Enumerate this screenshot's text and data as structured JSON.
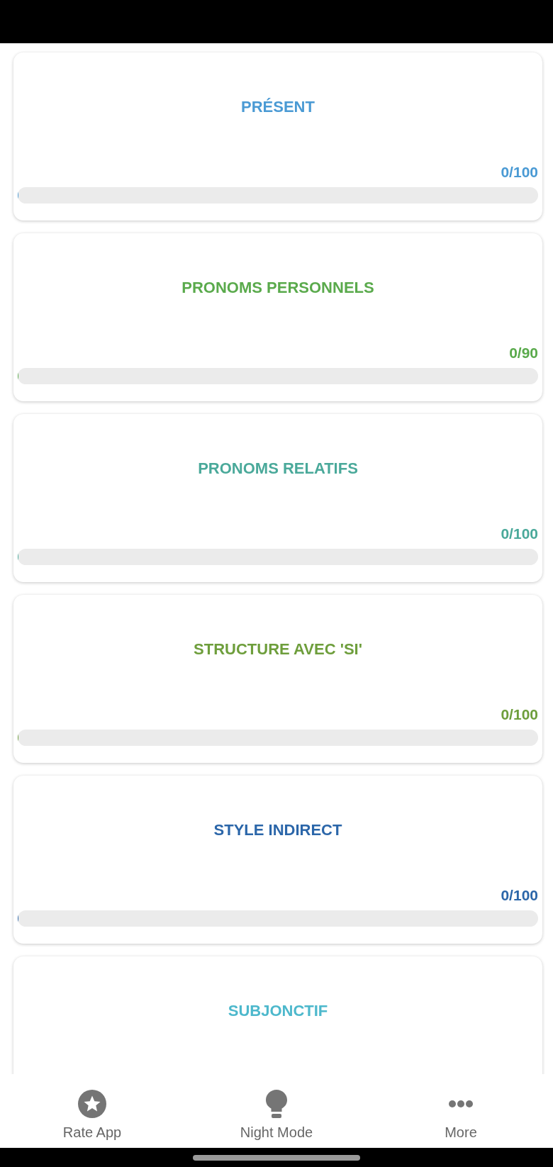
{
  "lessons": [
    {
      "title": "PRÉSENT",
      "color": "#4a9ad4",
      "score": "0/100",
      "level": 0
    },
    {
      "title": "PRONOMS PERSONNELS",
      "color": "#5aaa4c",
      "score": "0/90",
      "level": 0
    },
    {
      "title": "PRONOMS RELATIFS",
      "color": "#4aa99a",
      "score": "0/100",
      "level": 0
    },
    {
      "title": "STRUCTURE AVEC 'SI'",
      "color": "#6e9e3c",
      "score": "0/100",
      "level": 0
    },
    {
      "title": "STYLE INDIRECT",
      "color": "#2b66a9",
      "score": "0/100",
      "level": 0
    },
    {
      "title": "SUBJONCTIF",
      "color": "#4db8cc"
    }
  ],
  "bottom_nav": [
    {
      "label": "Rate App",
      "kind": "rate"
    },
    {
      "label": "Night Mode",
      "kind": "night"
    },
    {
      "label": "More",
      "kind": "more"
    }
  ]
}
